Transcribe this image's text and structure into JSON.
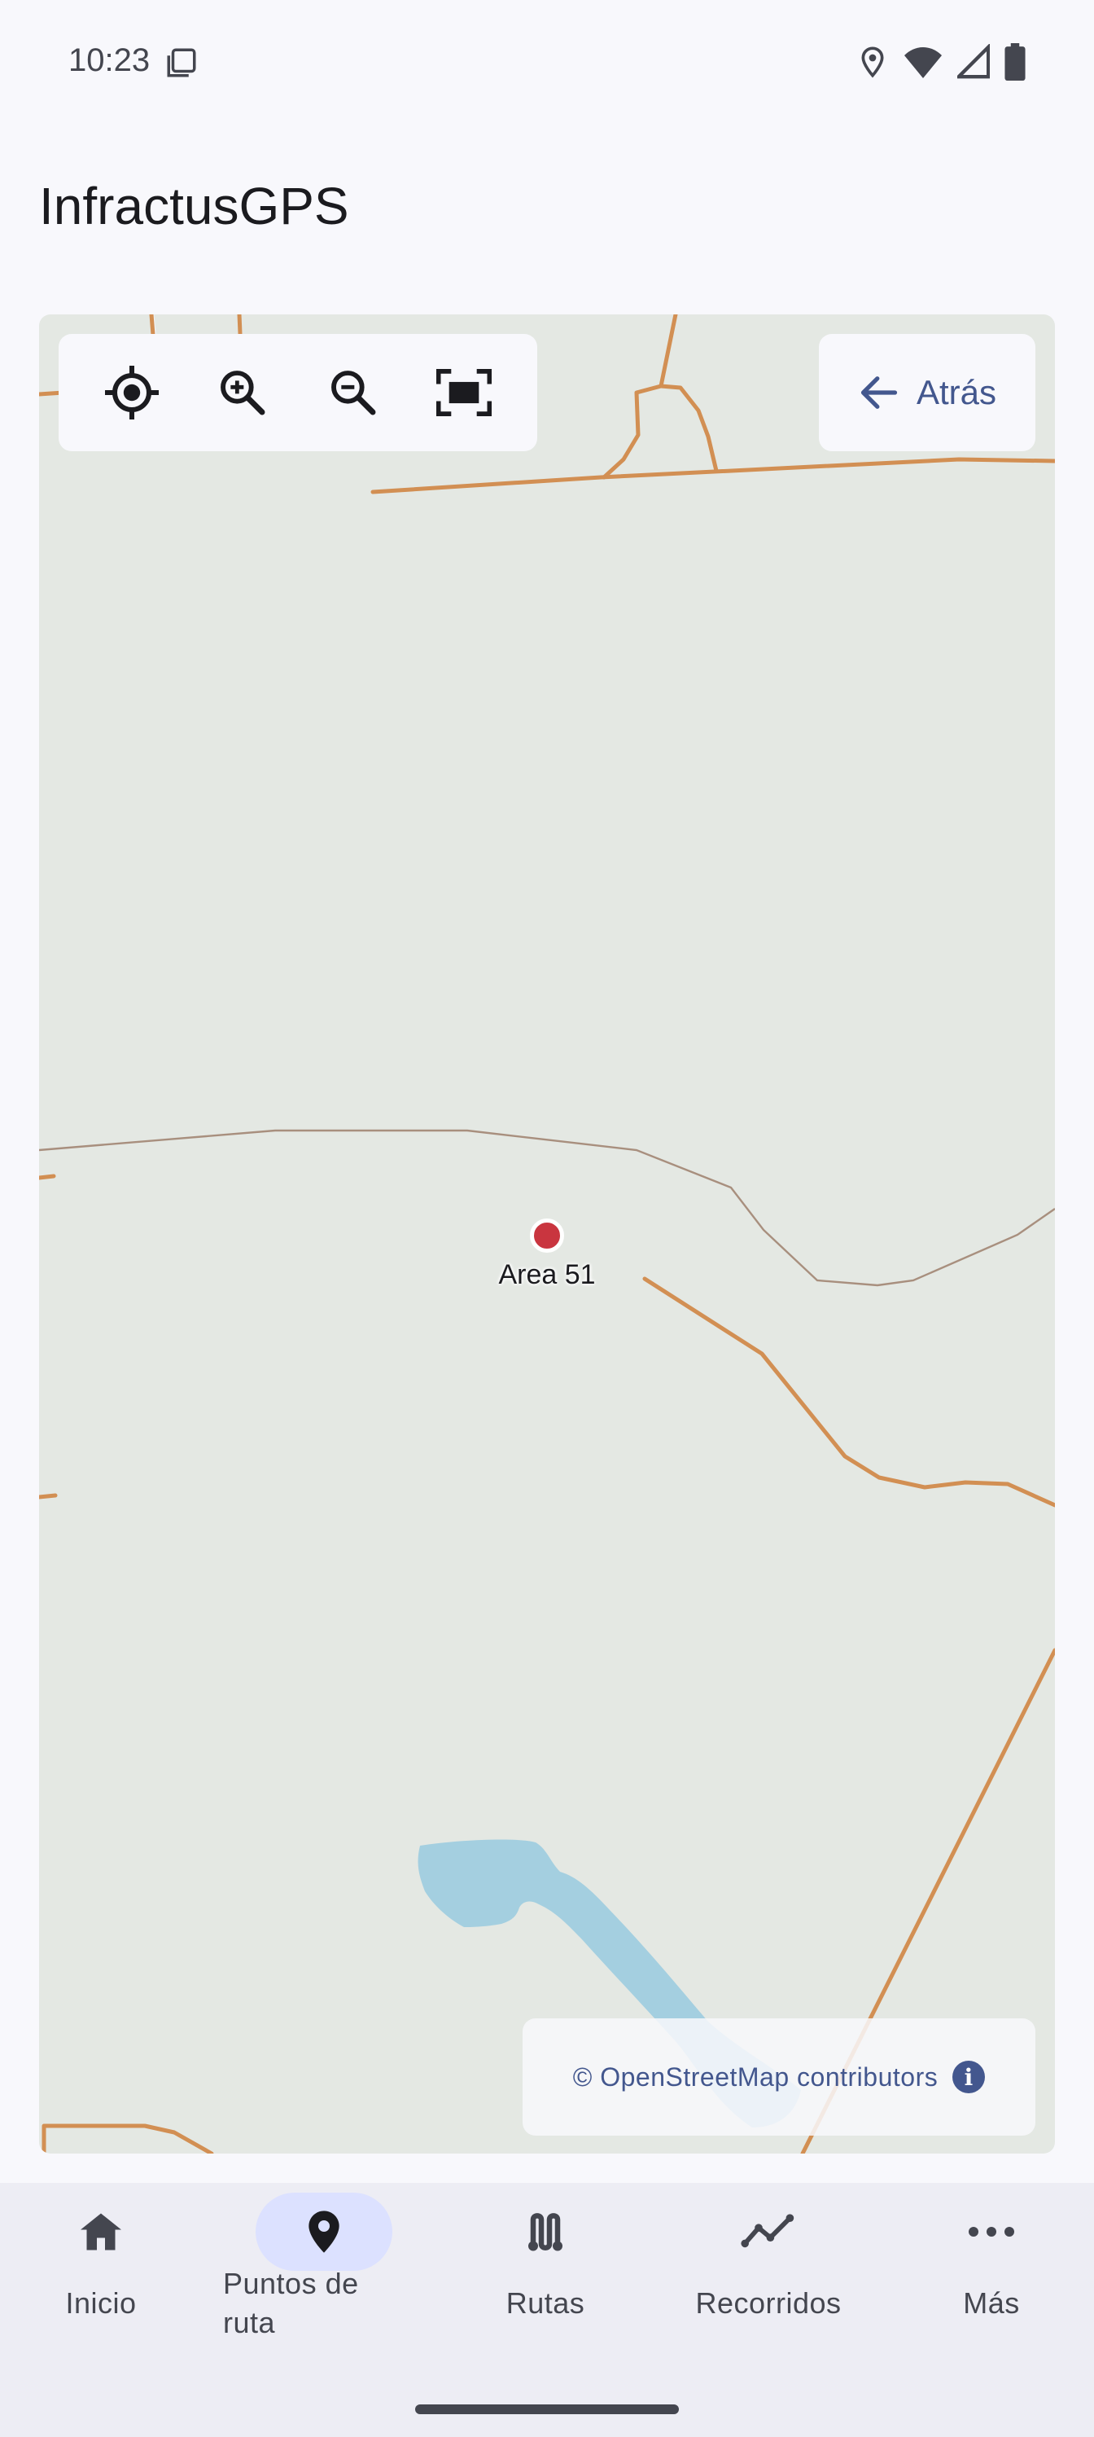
{
  "status_bar": {
    "time": "10:23"
  },
  "app": {
    "title": "InfractusGPS"
  },
  "map": {
    "controls": {
      "my_location": "my-location-icon",
      "zoom_in": "zoom-in-icon",
      "zoom_out": "zoom-out-icon",
      "fit_bounds": "fit-screen-icon"
    },
    "back_button": {
      "label": "Atrás"
    },
    "waypoint": {
      "label": "Area 51",
      "color": "#c9353f"
    },
    "attribution": {
      "text": "© OpenStreetMap contributors"
    },
    "colors": {
      "background": "#e4e8e3",
      "road": "#d28f53",
      "boundary": "#a88f7e",
      "water": "#a4cfe0"
    }
  },
  "bottom_nav": {
    "items": [
      {
        "label": "Inicio",
        "icon": "home-icon",
        "active": false
      },
      {
        "label": "Puntos de ruta",
        "icon": "location-pin-icon",
        "active": true
      },
      {
        "label": "Rutas",
        "icon": "route-icon",
        "active": false
      },
      {
        "label": "Recorridos",
        "icon": "tracks-icon",
        "active": false
      },
      {
        "label": "Más",
        "icon": "more-icon",
        "active": false
      }
    ]
  },
  "accent_color": "#43578e"
}
